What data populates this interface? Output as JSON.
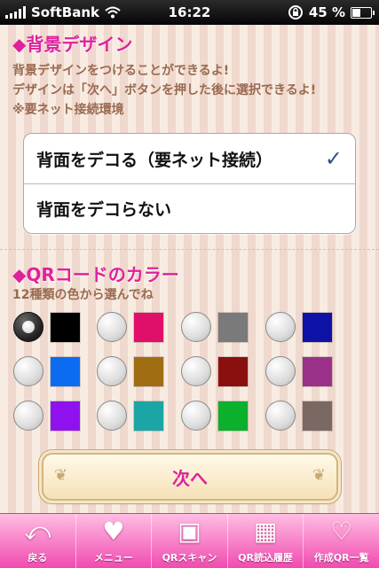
{
  "status_bar": {
    "carrier": "SoftBank",
    "time": "16:22",
    "battery": "45 %",
    "battery_level": 0.45
  },
  "background_section": {
    "title": "◆背景デザイン",
    "desc_lines": [
      "背景デザインをつけることができるよ!",
      "デザインは「次へ」ボタンを押した後に選択できるよ!",
      "※要ネット接続環境"
    ],
    "options": [
      {
        "label": "背面をデコる（要ネット接続）",
        "checked": true
      },
      {
        "label": "背面をデコらない",
        "checked": false
      }
    ],
    "checkmark": "✓"
  },
  "qr_color_section": {
    "title": "◆QRコードのカラー",
    "desc": "12種類の色から選んでね",
    "colors": [
      {
        "name": "black",
        "hex": "#000000",
        "selected": true
      },
      {
        "name": "magenta",
        "hex": "#e0106a",
        "selected": false
      },
      {
        "name": "gray",
        "hex": "#7a7a7a",
        "selected": false
      },
      {
        "name": "navy-blue",
        "hex": "#0f12a6",
        "selected": false
      },
      {
        "name": "blue",
        "hex": "#0b6cf2",
        "selected": false
      },
      {
        "name": "brown",
        "hex": "#a06d12",
        "selected": false
      },
      {
        "name": "dark-red",
        "hex": "#8a0f0f",
        "selected": false
      },
      {
        "name": "purple",
        "hex": "#9b3089",
        "selected": false
      },
      {
        "name": "violet",
        "hex": "#8f12ee",
        "selected": false
      },
      {
        "name": "teal",
        "hex": "#1ba5a5",
        "selected": false
      },
      {
        "name": "green",
        "hex": "#0bb02b",
        "selected": false
      },
      {
        "name": "taupe",
        "hex": "#7a6862",
        "selected": false
      }
    ]
  },
  "next_button": {
    "label": "次へ"
  },
  "tab_bar": {
    "items": [
      {
        "label": "戻る",
        "icon": "back-icon"
      },
      {
        "label": "メニュー",
        "icon": "heart-menu-icon"
      },
      {
        "label": "QRスキャン",
        "icon": "qr-scan-icon"
      },
      {
        "label": "QR読込履歴",
        "icon": "qr-history-icon"
      },
      {
        "label": "作成QR一覧",
        "icon": "qr-created-list-icon"
      }
    ]
  },
  "colors": {
    "accent_pink": "#e0219c",
    "desc_brown": "#9a6a50",
    "check_blue": "#324f85",
    "tab_pink": "#f04bb0"
  }
}
